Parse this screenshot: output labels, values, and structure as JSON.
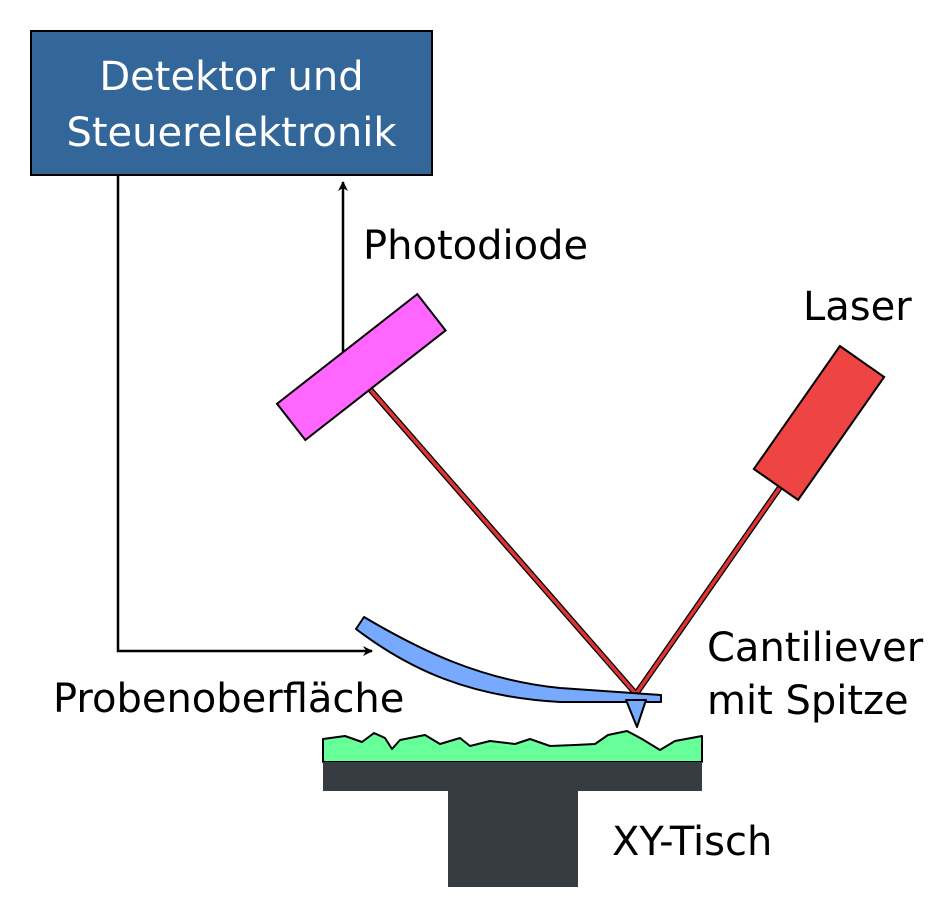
{
  "controller": {
    "line1": "Detektor und",
    "line2": "Steuerelektronik",
    "color": "#336699"
  },
  "labels": {
    "photodiode": "Photodiode",
    "laser": "Laser",
    "cantilever_line1": "Cantiliever",
    "cantilever_line2": "mit Spitze",
    "sample_surface": "Probenoberfläche",
    "stage": "XY-Tisch"
  },
  "colors": {
    "photodiode": "#ff66ff",
    "laser": "#ee4444",
    "beam": "#dd3333",
    "cantilever": "#77aaff",
    "sample": "#66ff99",
    "stage": "#373b42"
  }
}
